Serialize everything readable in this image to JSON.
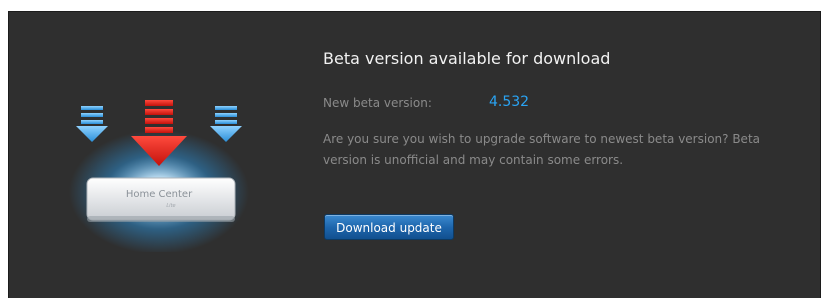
{
  "dialog": {
    "title": "Beta version available for download",
    "version_label": "New beta version:",
    "version_value": "4.532",
    "message": "Are you sure you wish to upgrade software to newest beta version? Beta version is unofficial and may contain some errors.",
    "download_button_label": "Download update"
  },
  "illustration": {
    "device_label": "Home Center",
    "device_sublabel": "Lite",
    "icons": [
      "blue-arrow-down-icon",
      "red-arrow-down-icon",
      "blue-arrow-down-icon"
    ]
  },
  "colors": {
    "panel_background": "#2f2f2f",
    "title_text": "#f2f2f2",
    "muted_text": "#8a8a8a",
    "accent_blue": "#2aa4f4",
    "button_blue": "#1e66ad",
    "arrow_red": "#e0221c",
    "arrow_blue": "#4fb3f0"
  }
}
